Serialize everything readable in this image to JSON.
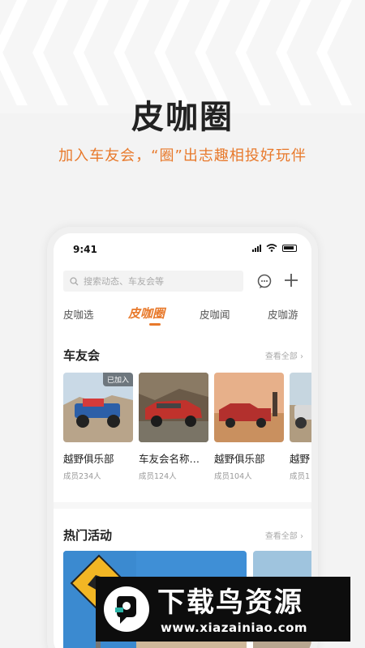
{
  "hero": {
    "title": "皮咖圈",
    "subtitle": "加入车友会，“圈”出志趣相投好玩伴"
  },
  "status_bar": {
    "time": "9:41"
  },
  "search": {
    "placeholder": "搜索动态、车友会等"
  },
  "tabs": [
    {
      "label": "皮咖选"
    },
    {
      "label": "皮咖圈",
      "active": true
    },
    {
      "label": "皮咖闻"
    },
    {
      "label": "皮咖游"
    }
  ],
  "clubs": {
    "title": "车友会",
    "more": "查看全部 ›",
    "items": [
      {
        "name": "越野俱乐部",
        "members": "成员234人",
        "badge": "已加入"
      },
      {
        "name": "车友会名称…",
        "members": "成员124人"
      },
      {
        "name": "越野俱乐部",
        "members": "成员104人"
      },
      {
        "name": "越野",
        "members": "成员1"
      }
    ]
  },
  "events": {
    "title": "热门活动",
    "more": "查看全部 ›"
  },
  "watermark": {
    "title": "下载鸟资源",
    "url": "www.xiazainiao.com"
  },
  "colors": {
    "accent": "#e8792b",
    "text": "#222222"
  }
}
